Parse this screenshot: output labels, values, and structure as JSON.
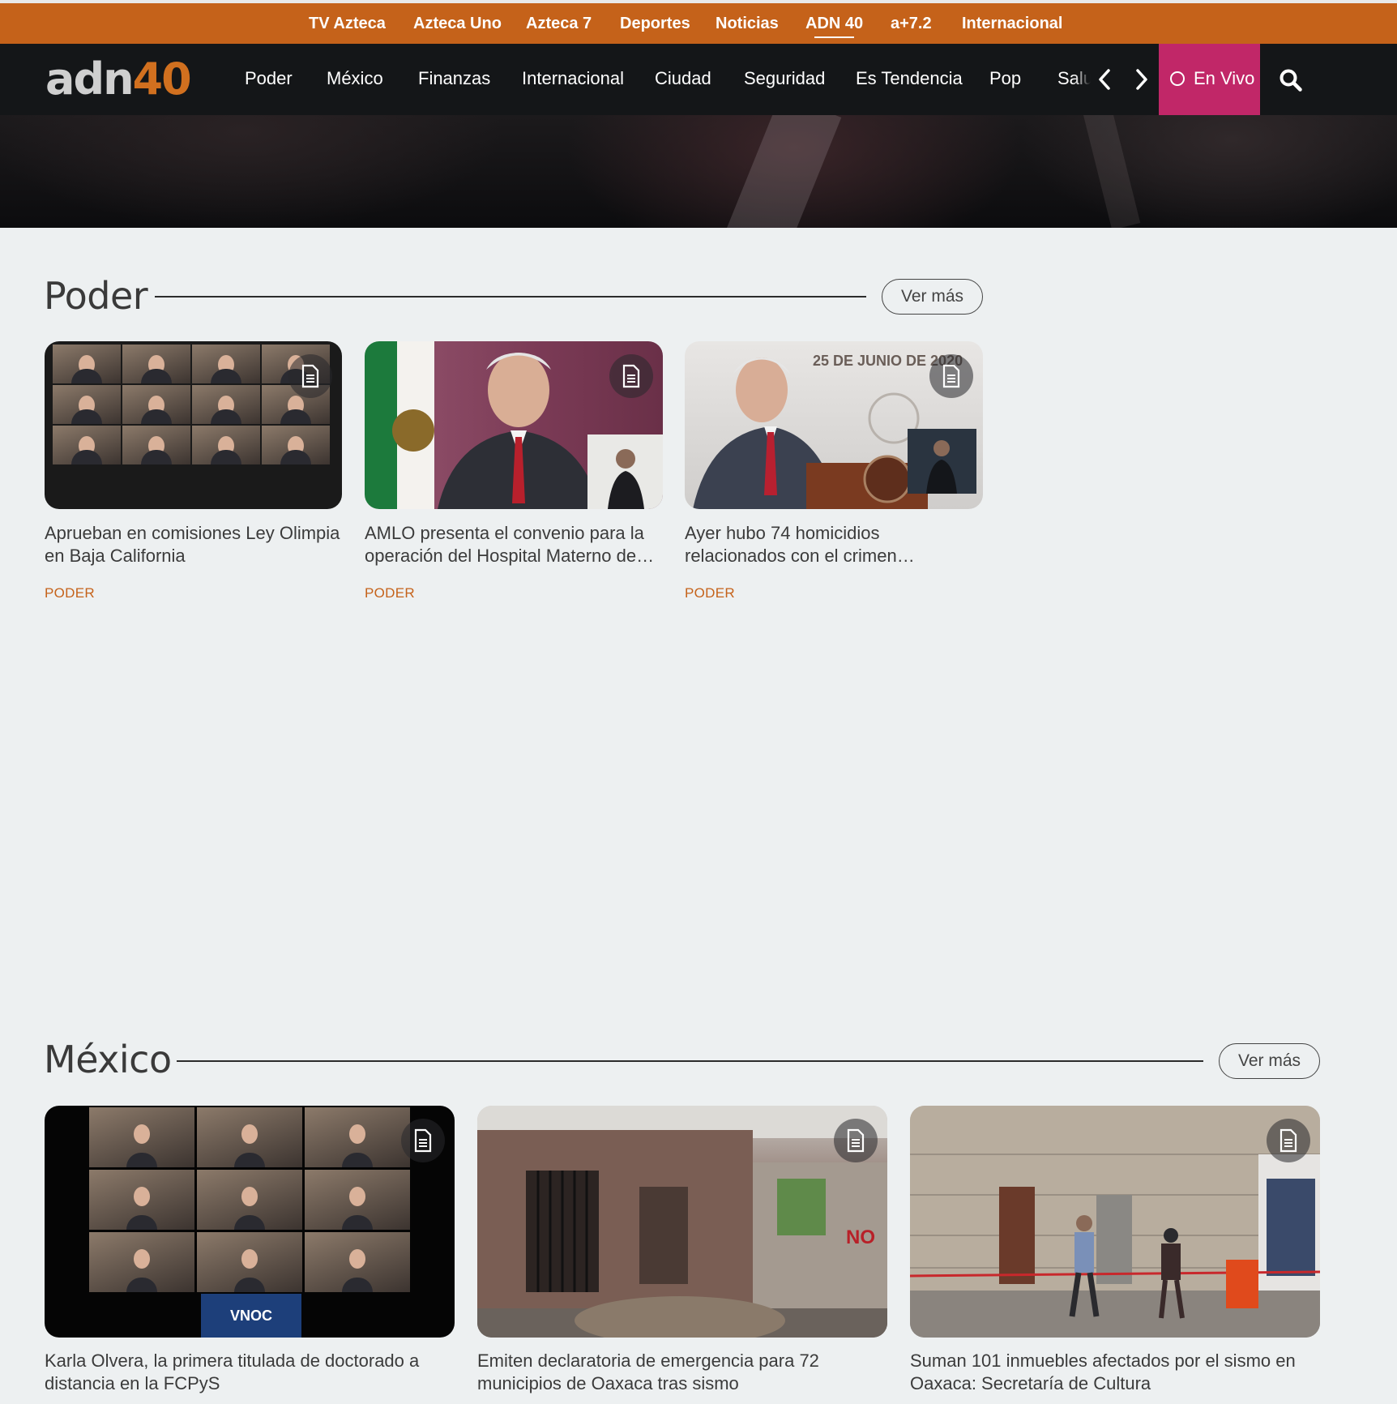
{
  "topbar": {
    "items": [
      "TV Azteca",
      "Azteca Uno",
      "Azteca 7",
      "Deportes",
      "Noticias",
      "ADN 40",
      "a+7.2",
      "Internacional"
    ],
    "active_index": 5,
    "bg_color": "#c5621a"
  },
  "mainnav": {
    "logo": {
      "part1": "adn",
      "part2": "40"
    },
    "items": [
      "Poder",
      "México",
      "Finanzas",
      "Internacional",
      "Ciudad",
      "Seguridad",
      "Es Tendencia",
      "Pop"
    ],
    "clipped_item": "Salud",
    "prev_icon": "chevron-left-icon",
    "next_icon": "chevron-right-icon",
    "live_label": "En Vivo",
    "live_color": "#c12768",
    "search_icon": "search-icon",
    "bg_color": "#141618"
  },
  "sections": [
    {
      "title": "Poder",
      "more_label": "Ver más",
      "cards": [
        {
          "title": "Aprueban en comisiones Ley Olimpia en Baja California",
          "tag": "PODER",
          "badge_icon": "document-icon"
        },
        {
          "title": "AMLO presenta el convenio para la operación del Hospital Materno de…",
          "tag": "PODER",
          "badge_icon": "document-icon"
        },
        {
          "title": "Ayer hubo 74 homicidios relacionados con el crimen…",
          "tag": "PODER",
          "badge_icon": "document-icon",
          "image_text": "25 DE JUNIO DE 2020"
        }
      ]
    },
    {
      "title": "México",
      "more_label": "Ver más",
      "cards": [
        {
          "title": "Karla Olvera, la primera titulada de doctorado a distancia en la FCPyS",
          "badge_icon": "document-icon",
          "image_text": "VNOC"
        },
        {
          "title": "Emiten declaratoria de emergencia para 72 municipios de Oaxaca tras sismo",
          "badge_icon": "document-icon"
        },
        {
          "title": "Suman 101 inmuebles afectados por el sismo en Oaxaca: Secretaría de Cultura",
          "badge_icon": "document-icon"
        }
      ]
    }
  ],
  "accent_color": "#c5621a"
}
